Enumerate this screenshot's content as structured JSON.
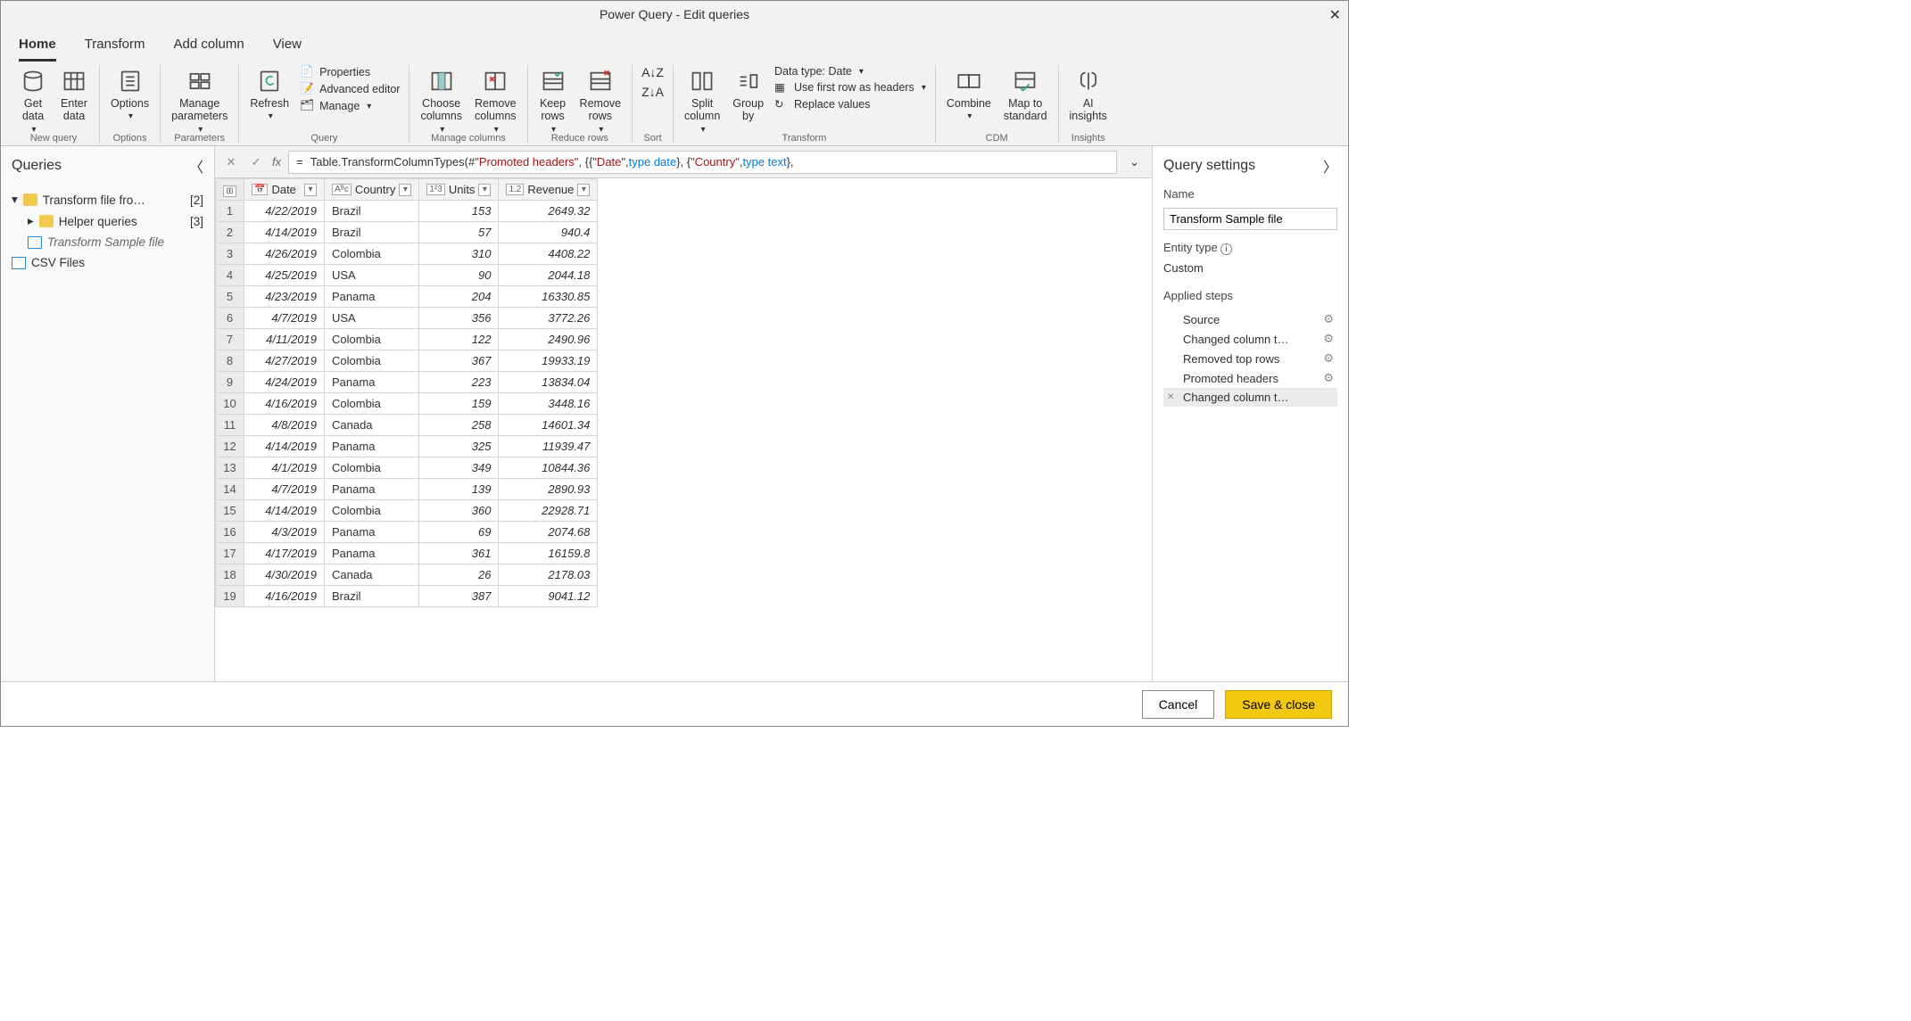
{
  "window": {
    "title": "Power Query - Edit queries"
  },
  "tabs": {
    "home": "Home",
    "transform": "Transform",
    "addcol": "Add column",
    "view": "View"
  },
  "ribbon": {
    "newquery": {
      "label": "New query",
      "getdata": "Get\ndata",
      "enterdata": "Enter\ndata"
    },
    "options": {
      "label": "Options",
      "options": "Options"
    },
    "parameters": {
      "label": "Parameters",
      "manage": "Manage\nparameters"
    },
    "query": {
      "label": "Query",
      "refresh": "Refresh",
      "properties": "Properties",
      "advanced": "Advanced editor",
      "manage": "Manage"
    },
    "managecols": {
      "label": "Manage columns",
      "choose": "Choose\ncolumns",
      "remove": "Remove\ncolumns"
    },
    "reduce": {
      "label": "Reduce rows",
      "keep": "Keep\nrows",
      "remove": "Remove\nrows"
    },
    "sort": {
      "label": "Sort"
    },
    "transform": {
      "label": "Transform",
      "split": "Split\ncolumn",
      "group": "Group\nby",
      "datatype": "Data type: Date",
      "firstrow": "Use first row as headers",
      "replace": "Replace values"
    },
    "cdm": {
      "label": "CDM",
      "combine": "Combine",
      "map": "Map to\nstandard"
    },
    "insights": {
      "label": "Insights",
      "ai": "AI\ninsights"
    }
  },
  "queries": {
    "title": "Queries",
    "items": [
      {
        "label": "Transform file fro…",
        "count": "[2]"
      },
      {
        "label": "Helper queries",
        "count": "[3]"
      },
      {
        "label": "Transform Sample file"
      },
      {
        "label": "CSV Files"
      }
    ]
  },
  "formula": {
    "prefix": "Table.TransformColumnTypes(#",
    "s1": "\"Promoted headers\"",
    "mid1": ", {{",
    "s2": "\"Date\"",
    "mid2": ", ",
    "kw1": "type date",
    "mid3": "}, {",
    "s3": "\"Country\"",
    "mid4": ", ",
    "kw2": "type text",
    "mid5": "},"
  },
  "columns": [
    "Date",
    "Country",
    "Units",
    "Revenue"
  ],
  "rows": [
    [
      "1",
      "4/22/2019",
      "Brazil",
      "153",
      "2649.32"
    ],
    [
      "2",
      "4/14/2019",
      "Brazil",
      "57",
      "940.4"
    ],
    [
      "3",
      "4/26/2019",
      "Colombia",
      "310",
      "4408.22"
    ],
    [
      "4",
      "4/25/2019",
      "USA",
      "90",
      "2044.18"
    ],
    [
      "5",
      "4/23/2019",
      "Panama",
      "204",
      "16330.85"
    ],
    [
      "6",
      "4/7/2019",
      "USA",
      "356",
      "3772.26"
    ],
    [
      "7",
      "4/11/2019",
      "Colombia",
      "122",
      "2490.96"
    ],
    [
      "8",
      "4/27/2019",
      "Colombia",
      "367",
      "19933.19"
    ],
    [
      "9",
      "4/24/2019",
      "Panama",
      "223",
      "13834.04"
    ],
    [
      "10",
      "4/16/2019",
      "Colombia",
      "159",
      "3448.16"
    ],
    [
      "11",
      "4/8/2019",
      "Canada",
      "258",
      "14601.34"
    ],
    [
      "12",
      "4/14/2019",
      "Panama",
      "325",
      "11939.47"
    ],
    [
      "13",
      "4/1/2019",
      "Colombia",
      "349",
      "10844.36"
    ],
    [
      "14",
      "4/7/2019",
      "Panama",
      "139",
      "2890.93"
    ],
    [
      "15",
      "4/14/2019",
      "Colombia",
      "360",
      "22928.71"
    ],
    [
      "16",
      "4/3/2019",
      "Panama",
      "69",
      "2074.68"
    ],
    [
      "17",
      "4/17/2019",
      "Panama",
      "361",
      "16159.8"
    ],
    [
      "18",
      "4/30/2019",
      "Canada",
      "26",
      "2178.03"
    ],
    [
      "19",
      "4/16/2019",
      "Brazil",
      "387",
      "9041.12"
    ]
  ],
  "settings": {
    "title": "Query settings",
    "name_label": "Name",
    "name_value": "Transform Sample file",
    "entity_label": "Entity type",
    "entity_value": "Custom",
    "steps_label": "Applied steps",
    "steps": [
      "Source",
      "Changed column t…",
      "Removed top rows",
      "Promoted headers",
      "Changed column t…"
    ]
  },
  "footer": {
    "cancel": "Cancel",
    "save": "Save & close"
  }
}
